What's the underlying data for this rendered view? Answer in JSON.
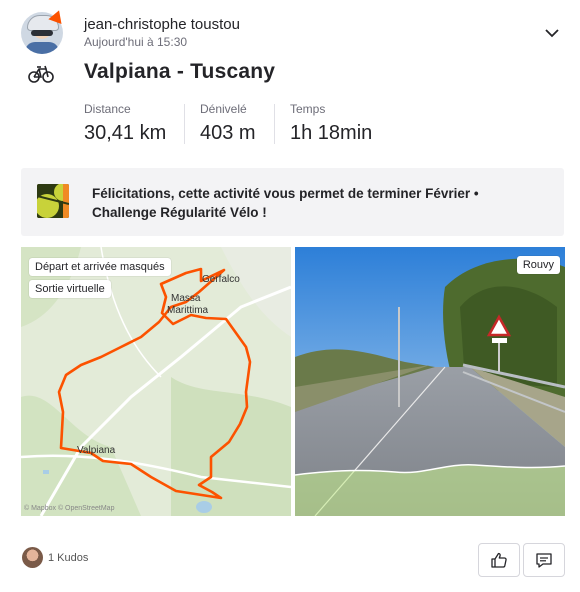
{
  "header": {
    "athlete_name": "jean-christophe toustou",
    "activity_time": "Aujourd'hui à 15:30"
  },
  "activity": {
    "title": "Valpiana - Tuscany",
    "sport_icon": "bike-icon",
    "stats": [
      {
        "label": "Distance",
        "value": "30,41 km"
      },
      {
        "label": "Dénivelé",
        "value": "403 m"
      },
      {
        "label": "Temps",
        "value": "1h 18min"
      }
    ]
  },
  "achievement": {
    "text": "Félicitations, cette activité vous permet de terminer Février • Challenge Régularité Vélo !"
  },
  "map": {
    "tags": [
      "Départ et arrivée masqués",
      "Sortie virtuelle"
    ],
    "places": [
      "Gerfalco",
      "Massa",
      "Marittima",
      "Valpiana"
    ],
    "attribution": "© Mapbox © OpenStreetMap",
    "route_color": "#fc5200"
  },
  "photo": {
    "location_badge": "Rouvy"
  },
  "footer": {
    "kudos_count": "1 Kudos"
  },
  "colors": {
    "accent": "#fc5200",
    "text": "#242428",
    "muted": "#6d6d78"
  }
}
